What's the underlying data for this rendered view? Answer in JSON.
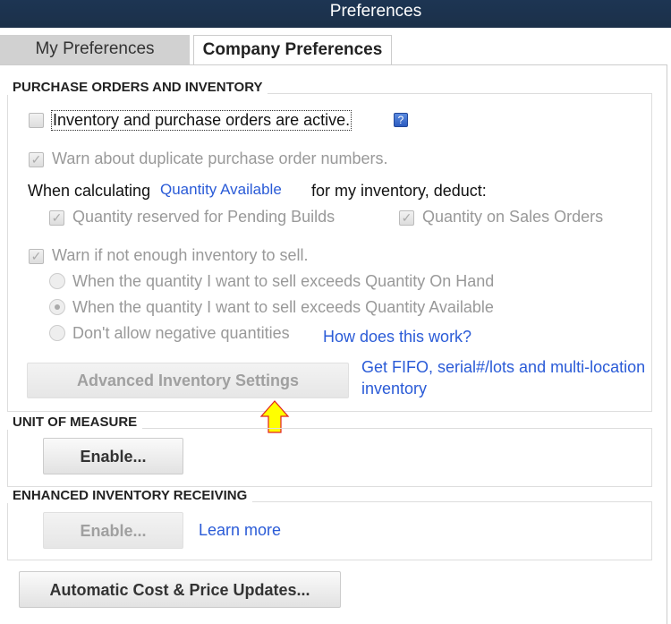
{
  "window": {
    "title": "Preferences"
  },
  "tabs": [
    {
      "label": "My Preferences",
      "active": false
    },
    {
      "label": "Company Preferences",
      "active": true
    }
  ],
  "po_inventory": {
    "heading": "PURCHASE ORDERS AND INVENTORY",
    "inventory_active": {
      "label": "Inventory and purchase orders are active.",
      "checked": false
    },
    "help_icon": "?",
    "warn_duplicate": {
      "label": "Warn about duplicate purchase order numbers.",
      "checked": true
    },
    "calc_prefix": "When calculating",
    "calc_link": "Quantity Available",
    "calc_suffix": "for my inventory, deduct:",
    "reserved_builds": {
      "label": "Quantity reserved for Pending Builds",
      "checked": true
    },
    "sales_orders": {
      "label": "Quantity on Sales Orders",
      "checked": true
    },
    "warn_not_enough": {
      "label": "Warn if not enough inventory to sell.",
      "checked": true
    },
    "radios": [
      {
        "label": "When the quantity I want to sell exceeds Quantity On Hand",
        "selected": false
      },
      {
        "label": "When the quantity I want to sell exceeds Quantity Available",
        "selected": true
      },
      {
        "label": "Don't allow negative quantities",
        "selected": false
      }
    ],
    "how_link": "How does this work?",
    "advanced_button": "Advanced Inventory Settings",
    "fifo_link_line1": "Get FIFO, serial#/lots and multi-location",
    "fifo_link_line2": "inventory"
  },
  "unit_of_measure": {
    "heading": "UNIT OF MEASURE",
    "enable_button": "Enable..."
  },
  "enhanced_receiving": {
    "heading": "ENHANCED INVENTORY RECEIVING",
    "enable_button": "Enable...",
    "learn_more": "Learn more"
  },
  "auto_cost_button": "Automatic Cost & Price Updates...",
  "colors": {
    "title_bar": "#1d3553",
    "link": "#2a5bd7",
    "arrow": "#ffff00"
  }
}
